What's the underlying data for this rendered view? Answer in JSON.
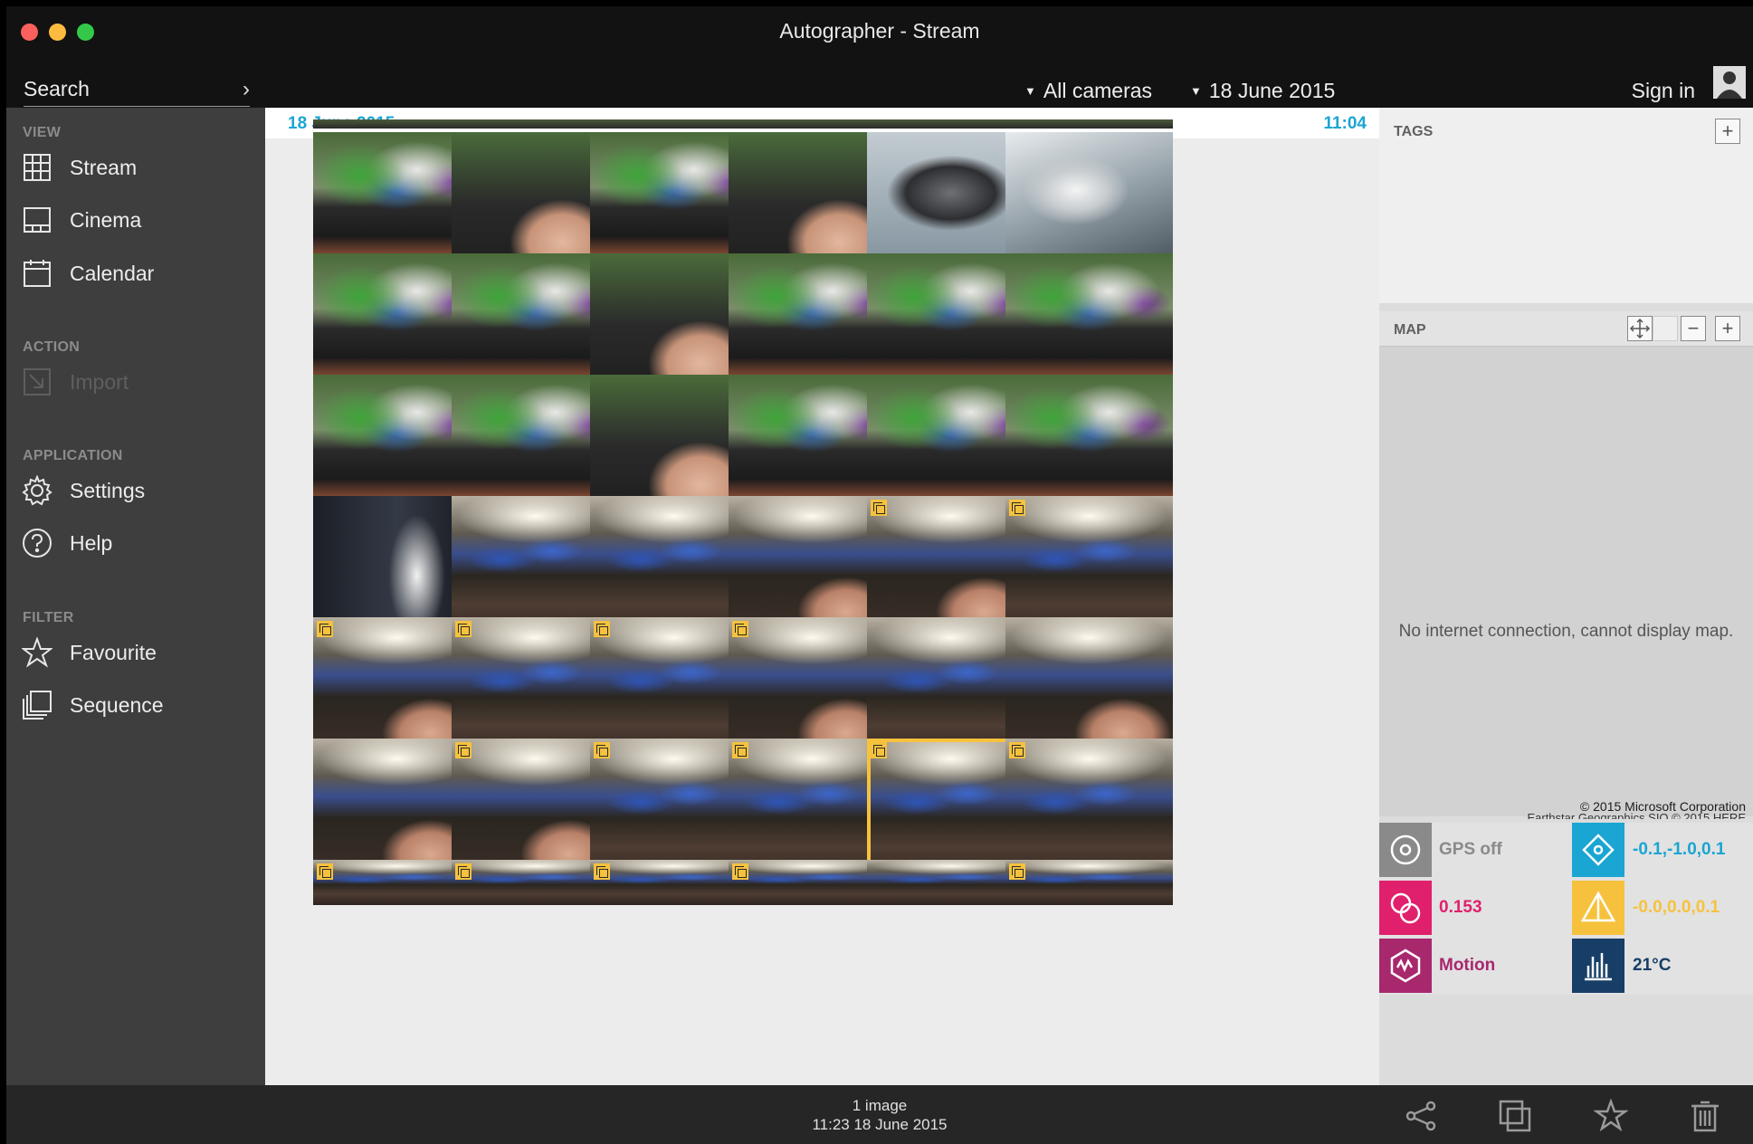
{
  "window": {
    "title": "Autographer - Stream"
  },
  "toolbar": {
    "search_placeholder": "Search",
    "search_go": "›",
    "camera_filter": "All cameras",
    "date_filter": "18 June 2015",
    "sign_in": "Sign in"
  },
  "sidebar": {
    "view_heading": "VIEW",
    "stream": "Stream",
    "cinema": "Cinema",
    "calendar": "Calendar",
    "action_heading": "ACTION",
    "import": "Import",
    "application_heading": "APPLICATION",
    "settings": "Settings",
    "help": "Help",
    "filter_heading": "FILTER",
    "favourite": "Favourite",
    "sequence": "Sequence"
  },
  "stream": {
    "date": "18 June 2015",
    "time": "11:04"
  },
  "panel": {
    "tags_title": "TAGS",
    "tags_add": "+",
    "map_title": "MAP",
    "map_zoom_out": "−",
    "map_zoom_in": "+",
    "map_message": "No internet connection, cannot display map.",
    "map_copyright": "© 2015 Microsoft Corporation",
    "map_copyright_2": "Earthstar Geographics SIO © 2015 HERE"
  },
  "sensors": {
    "gps": "GPS off",
    "accel": "-0.1,-1.0,0.1",
    "light": "0.153",
    "magnet": "-0.0,0.0,0.1",
    "motion": "Motion",
    "temperature": "21°C"
  },
  "status": {
    "count": "1 image",
    "timestamp": "11:23 18 June 2015"
  },
  "colors": {
    "accent_blue": "#1aa5d3",
    "sequence_yellow": "#f6c23e",
    "gps_gray": "#8a8a8a",
    "light_pink": "#e0206c",
    "motion_purple": "#a8286e",
    "temp_navy": "#173e67"
  },
  "icons": {
    "stream": "grid-icon",
    "cinema": "cinema-icon",
    "calendar": "calendar-icon",
    "import": "import-icon",
    "settings": "gear-icon",
    "help": "help-icon",
    "favourite": "star-icon",
    "sequence": "sequence-icon",
    "share": "share-icon",
    "duplicate": "duplicate-icon",
    "star": "star-icon",
    "delete": "trash-icon"
  }
}
